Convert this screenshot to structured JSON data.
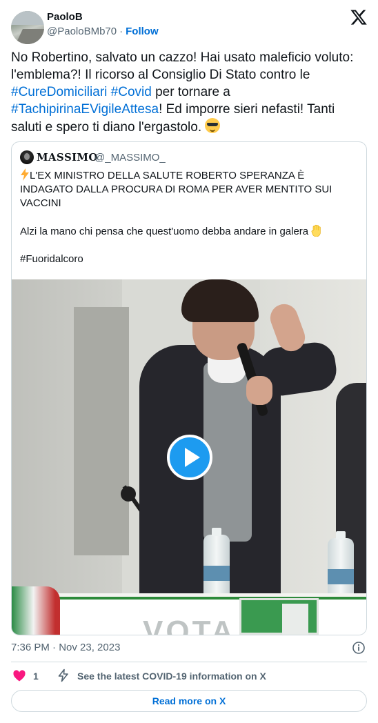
{
  "author": {
    "display_name": "PaoloB",
    "handle": "@PaoloBMb70",
    "separator": "·",
    "follow_label": "Follow",
    "avatar_icon": "profile-photo"
  },
  "brand": {
    "icon": "x-logo"
  },
  "tweet": {
    "text_1": "No Robertino, salvato un cazzo! Hai usato maleficio voluto: l'emblema?! Il ricorso al Consiglio Di Stato contro le ",
    "hashtag_1": "#CureDomiciliari",
    "text_2": " ",
    "hashtag_2": "#Covid",
    "text_3": " per tornare a ",
    "hashtag_3": "#TachipirinaEVigileAttesa",
    "text_4": "! Ed imporre sieri nefasti! Tanti saluti e spero ti diano l'ergastolo. ",
    "emoji": "smiling-face-with-sunglasses"
  },
  "quoted_tweet": {
    "display_name": "𝐌𝐀𝐒𝐒𝐈𝐌𝐎",
    "handle": "@_MASSIMO_",
    "text_main": "L'EX MINISTRO DELLA SALUTE ROBERTO SPERANZA È INDAGATO DALLA PROCURA DI ROMA PER AVER MENTITO SUI VACCINI",
    "text_second": "Alzi la mano chi pensa che quest'uomo debba andare in galera",
    "text_tag": "#Fuoridalcoro",
    "lead_emoji": "lightning-bolt",
    "hand_emoji": "raised-hand",
    "media": {
      "type": "video",
      "play_icon": "play-button",
      "banner_text": "VOTA"
    }
  },
  "meta": {
    "timestamp": "7:36 PM · Nov 23, 2023",
    "info_icon": "info-circle"
  },
  "actions": {
    "like_count": "1",
    "like_icon": "heart",
    "covid_icon": "lightning-bolt-outline",
    "covid_label": "See the latest COVID-19 information on X",
    "read_more_label": "Read more on X"
  },
  "colors": {
    "link_blue": "#006fd6",
    "text_primary": "#0f1419",
    "text_secondary": "#536471",
    "border": "#cfd9de",
    "heart_pink": "#f91880",
    "play_blue": "#1d9bf0"
  }
}
